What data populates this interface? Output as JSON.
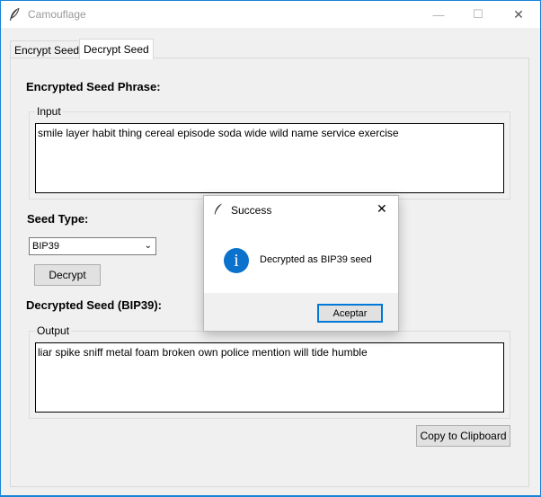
{
  "window": {
    "title": "Camouflage",
    "minimize_glyph": "—",
    "maximize_glyph": "☐",
    "close_glyph": "✕"
  },
  "tabs": [
    {
      "label": "Encrypt Seed",
      "active": false
    },
    {
      "label": "Decrypt Seed",
      "active": true
    }
  ],
  "decrypt": {
    "heading": "Encrypted Seed Phrase:",
    "input_label": "Input",
    "input_value": "smile layer habit thing cereal episode soda wide wild name service exercise",
    "seed_type_heading": "Seed Type:",
    "seed_type_value": "BIP39",
    "decrypt_button": "Decrypt",
    "result_heading": "Decrypted Seed (BIP39):",
    "output_label": "Output",
    "output_value": "liar spike sniff metal foam broken own police mention will tide humble",
    "copy_button": "Copy to Clipboard"
  },
  "dialog": {
    "title": "Success",
    "icon": "info-icon",
    "message": "Decrypted as BIP39 seed",
    "ok_button": "Aceptar",
    "close_glyph": "✕"
  },
  "colors": {
    "accent": "#1883d7",
    "info_icon": "#0a71cc"
  }
}
